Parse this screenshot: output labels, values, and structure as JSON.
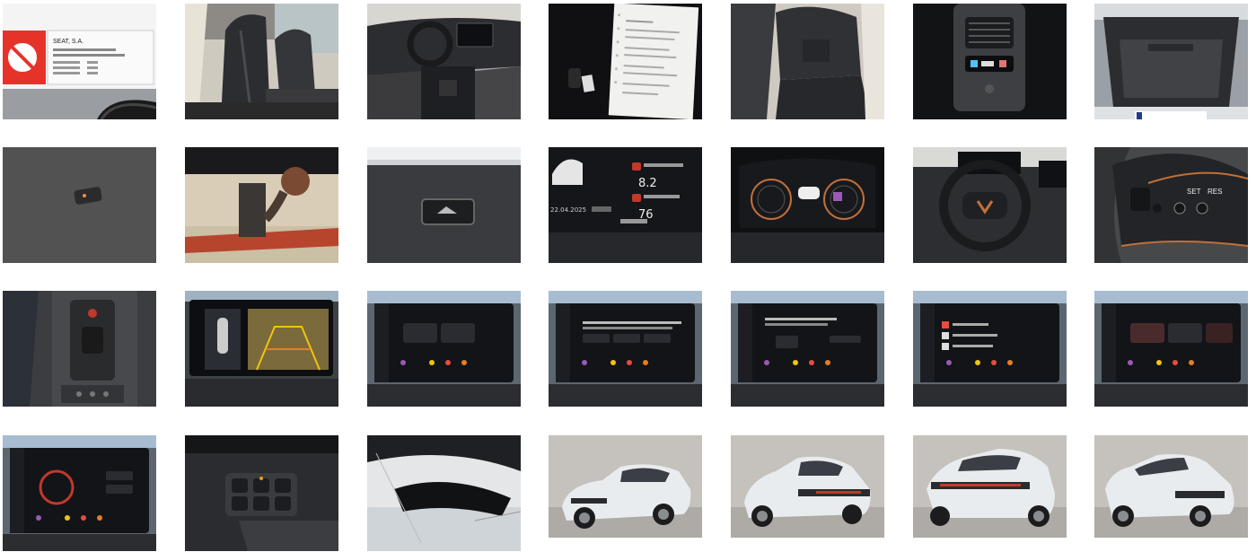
{
  "gallery": {
    "photos": [
      {
        "subject": "vin-plate-sticker",
        "texts": {
          "maker": "SEAT, S.A."
        }
      },
      {
        "subject": "front-seats"
      },
      {
        "subject": "dashboard-interior"
      },
      {
        "subject": "manual-and-keys"
      },
      {
        "subject": "rear-seats"
      },
      {
        "subject": "rear-air-vents"
      },
      {
        "subject": "trunk"
      },
      {
        "subject": "trunk-socket"
      },
      {
        "subject": "tow-hitch"
      },
      {
        "subject": "trunk-button"
      },
      {
        "subject": "instrument-cluster-closeup",
        "texts": {
          "consumption_value": "8.2",
          "speed_value": "76",
          "date": "22.04.2025"
        }
      },
      {
        "subject": "digital-cockpit"
      },
      {
        "subject": "steering-wheel"
      },
      {
        "subject": "steering-wheel-buttons",
        "texts": {
          "set": "SET",
          "res": "RES"
        }
      },
      {
        "subject": "gear-selector-console"
      },
      {
        "subject": "infotainment-parking-camera"
      },
      {
        "subject": "infotainment-menu-1"
      },
      {
        "subject": "infotainment-menu-2"
      },
      {
        "subject": "infotainment-menu-3"
      },
      {
        "subject": "infotainment-menu-4"
      },
      {
        "subject": "infotainment-menu-5"
      },
      {
        "subject": "infotainment-ambient-light"
      },
      {
        "subject": "headlight-switch-panel"
      },
      {
        "subject": "rearview-mirror"
      },
      {
        "subject": "exterior-front-left"
      },
      {
        "subject": "exterior-rear-left"
      },
      {
        "subject": "exterior-rear-right"
      },
      {
        "subject": "exterior-front-right"
      }
    ]
  },
  "colors": {
    "background": "#ffffff",
    "car_white": "#e9ecee",
    "studio_floor": "#bdb9b4",
    "interior_dark": "#2a2b2e",
    "screen_dark": "#121418",
    "accent_copper": "#c0703a"
  }
}
